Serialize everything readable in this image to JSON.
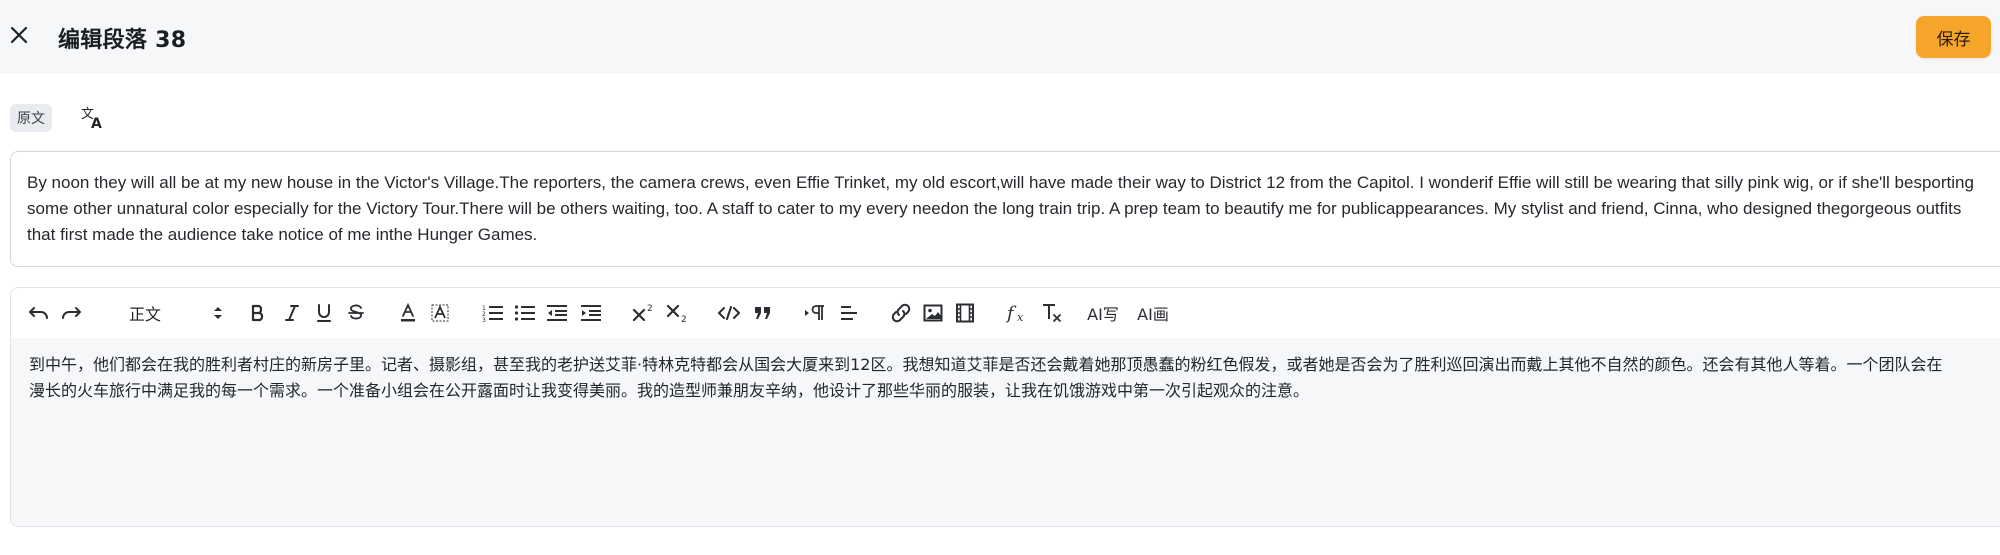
{
  "header": {
    "title": "编辑段落 38",
    "save_label": "保存",
    "close_icon": "close-icon"
  },
  "tabs": {
    "original_label": "原文",
    "translate_icon": "translate-icon"
  },
  "source": {
    "text": "By noon they will all be at my new house in the Victor's Village.The reporters, the camera crews, even Effie Trinket, my old escort,will have made their way to District 12 from the Capitol. I wonderif Effie will still be wearing that silly pink wig, or if she'll besporting\nsome other unnatural color especially for the Victory Tour.There will be others waiting, too. A staff to cater to my every needon the long train trip. A prep team to beautify me for publicappearances. My stylist and friend, Cinna, who designed thegorgeous outfits\nthat first made the audience take notice of me inthe Hunger Games."
  },
  "toolbar": {
    "paragraph_format": "正文",
    "ai_write_label": "AI写",
    "ai_draw_label": "AI画",
    "icons": [
      "undo-icon",
      "redo-icon",
      "paragraph-format-select",
      "bold-icon",
      "italic-icon",
      "underline-icon",
      "strikethrough-icon",
      "font-color-icon",
      "background-color-icon",
      "ordered-list-icon",
      "bullet-list-icon",
      "outdent-icon",
      "indent-icon",
      "superscript-icon",
      "subscript-icon",
      "code-icon",
      "quote-icon",
      "text-direction-icon",
      "align-icon",
      "link-icon",
      "image-icon",
      "video-icon",
      "formula-icon",
      "clear-format-icon"
    ]
  },
  "editor": {
    "content": "到中午，他们都会在我的胜利者村庄的新房子里。记者、摄影组，甚至我的老护送艾菲·特林克特都会从国会大厦来到12区。我想知道艾菲是否还会戴着她那顶愚蠢的粉红色假发，或者她是否会为了胜利巡回演出而戴上其他不自然的颜色。还会有其他人等着。一个团队会在\n漫长的火车旅行中满足我的每一个需求。一个准备小组会在公开露面时让我变得美丽。我的造型师兼朋友辛纳，他设计了那些华丽的服装，让我在饥饿游戏中第一次引起观众的注意。"
  },
  "colors": {
    "accent": "#f6a52b",
    "header_bg": "#f6f7f9",
    "editor_bg": "#f6f7f9"
  }
}
